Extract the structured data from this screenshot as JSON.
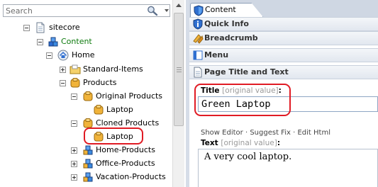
{
  "search": {
    "placeholder": "Search"
  },
  "tree": {
    "sitecore": "sitecore",
    "content": "Content",
    "home": "Home",
    "standard_items": "Standard-Items",
    "products": "Products",
    "original_products": "Original Products",
    "laptop_original": "Laptop",
    "cloned_products": "Cloned Products",
    "laptop_cloned": "Laptop",
    "home_products": "Home-Products",
    "office_products": "Office-Products",
    "vacation_products": "Vacation-Products"
  },
  "editor": {
    "tab_label": "Content",
    "sections": {
      "quick_info": "Quick Info",
      "breadcrumb": "Breadcrumb",
      "menu": "Menu",
      "page_title_text": "Page Title and Text"
    },
    "title_field": {
      "label": "Title",
      "note": "[original value]",
      "colon": ":",
      "value": "Green Laptop"
    },
    "actions": {
      "show_editor": "Show Editor",
      "suggest_fix": "Suggest Fix",
      "edit_html": "Edit Html",
      "separator": "·"
    },
    "text_field": {
      "label": "Text",
      "note": "[original value]",
      "colon": ":",
      "value": "A very cool laptop."
    }
  },
  "colors": {
    "highlight": "#e01b24",
    "content_green": "#0d7a0d",
    "tab_bar": "#cfd7e3"
  }
}
